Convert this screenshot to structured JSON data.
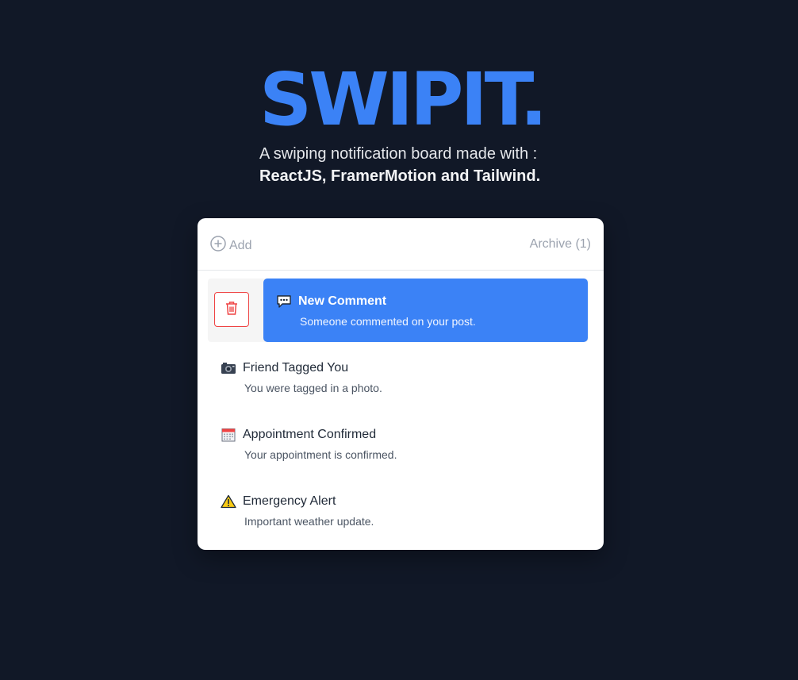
{
  "hero": {
    "title": "SWIPIT.",
    "subtitle": "A swiping notification board made with :",
    "subtitle_bold": "ReactJS, FramerMotion and Tailwind."
  },
  "header": {
    "add_label": "Add",
    "archive_label": "Archive (1)"
  },
  "colors": {
    "accent": "#3b82f6",
    "background": "#111827",
    "danger": "#ef4444"
  },
  "notifications": [
    {
      "icon": "speech-balloon-icon",
      "title": "New Comment",
      "description": "Someone commented on your post.",
      "state": "swiped"
    },
    {
      "icon": "camera-icon",
      "title": "Friend Tagged You",
      "description": "You were tagged in a photo."
    },
    {
      "icon": "calendar-icon",
      "title": "Appointment Confirmed",
      "description": "Your appointment is confirmed."
    },
    {
      "icon": "warning-icon",
      "title": "Emergency Alert",
      "description": "Important weather update."
    }
  ]
}
